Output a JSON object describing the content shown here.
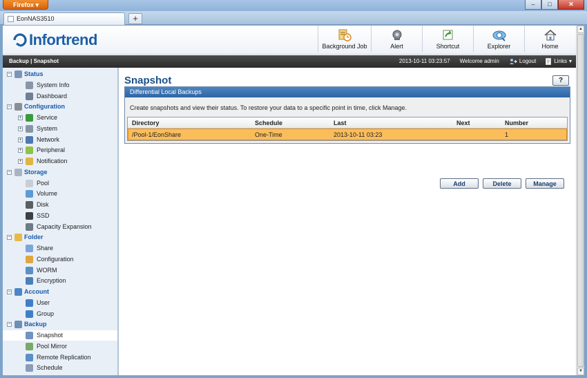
{
  "browser": {
    "app_button": "Firefox",
    "tab_title": "EonNAS3510",
    "new_tab": "+",
    "window_controls": {
      "minimize": "–",
      "maximize": "□",
      "close": "✕"
    }
  },
  "app": {
    "logo_text": "Infortrend",
    "nav": [
      {
        "label": "Background Job",
        "icon": "background-job-icon"
      },
      {
        "label": "Alert",
        "icon": "alert-icon"
      },
      {
        "label": "Shortcut",
        "icon": "shortcut-icon"
      },
      {
        "label": "Explorer",
        "icon": "explorer-icon"
      },
      {
        "label": "Home",
        "icon": "home-icon"
      }
    ]
  },
  "statusbar": {
    "breadcrumb": "Backup | Snapshot",
    "datetime": "2013-10-11 03:23:57",
    "welcome": "Welcome admin",
    "logout": "Logout",
    "links": "Links"
  },
  "sidebar": {
    "groups": [
      {
        "label": "Status",
        "icon": "status-icon",
        "items": [
          {
            "label": "System Info",
            "icon": "system-info-icon"
          },
          {
            "label": "Dashboard",
            "icon": "dashboard-icon"
          }
        ]
      },
      {
        "label": "Configuration",
        "icon": "configuration-icon",
        "items": [
          {
            "label": "Service",
            "icon": "service-icon",
            "expandable": true
          },
          {
            "label": "System",
            "icon": "system-icon",
            "expandable": true
          },
          {
            "label": "Network",
            "icon": "network-icon",
            "expandable": true
          },
          {
            "label": "Peripheral",
            "icon": "peripheral-icon",
            "expandable": true
          },
          {
            "label": "Notification",
            "icon": "notification-icon",
            "expandable": true
          }
        ]
      },
      {
        "label": "Storage",
        "icon": "storage-icon",
        "items": [
          {
            "label": "Pool",
            "icon": "pool-icon"
          },
          {
            "label": "Volume",
            "icon": "volume-icon"
          },
          {
            "label": "Disk",
            "icon": "disk-icon"
          },
          {
            "label": "SSD",
            "icon": "ssd-icon"
          },
          {
            "label": "Capacity Expansion",
            "icon": "capacity-expansion-icon"
          }
        ]
      },
      {
        "label": "Folder",
        "icon": "folder-icon",
        "items": [
          {
            "label": "Share",
            "icon": "share-icon"
          },
          {
            "label": "Configuration",
            "icon": "folder-configuration-icon"
          },
          {
            "label": "WORM",
            "icon": "worm-icon"
          },
          {
            "label": "Encryption",
            "icon": "encryption-icon"
          }
        ]
      },
      {
        "label": "Account",
        "icon": "account-icon",
        "items": [
          {
            "label": "User",
            "icon": "user-icon"
          },
          {
            "label": "Group",
            "icon": "group-icon"
          }
        ]
      },
      {
        "label": "Backup",
        "icon": "backup-icon",
        "items": [
          {
            "label": "Snapshot",
            "icon": "snapshot-icon",
            "selected": true
          },
          {
            "label": "Pool Mirror",
            "icon": "pool-mirror-icon"
          },
          {
            "label": "Remote Replication",
            "icon": "remote-replication-icon"
          },
          {
            "label": "Schedule",
            "icon": "schedule-icon"
          }
        ]
      }
    ]
  },
  "main": {
    "title": "Snapshot",
    "help": "?",
    "panel_title": "Differential Local Backups",
    "description": "Create snapshots and view their status. To restore your data to a specific point in time, click Manage.",
    "table": {
      "headers": [
        "Directory",
        "Schedule",
        "Last",
        "Next",
        "Number"
      ],
      "rows": [
        [
          "/Pool-1/EonShare",
          "One-Time",
          "2013-10-11 03:23",
          "",
          "1"
        ]
      ]
    },
    "buttons": {
      "add": "Add",
      "delete": "Delete",
      "manage": "Manage"
    }
  },
  "colors": {
    "accent": "#1b5fa6",
    "selected_row": "#fbbd5a",
    "panel_header": "#3a72b3",
    "sidebar_bg": "#e8eff7"
  }
}
